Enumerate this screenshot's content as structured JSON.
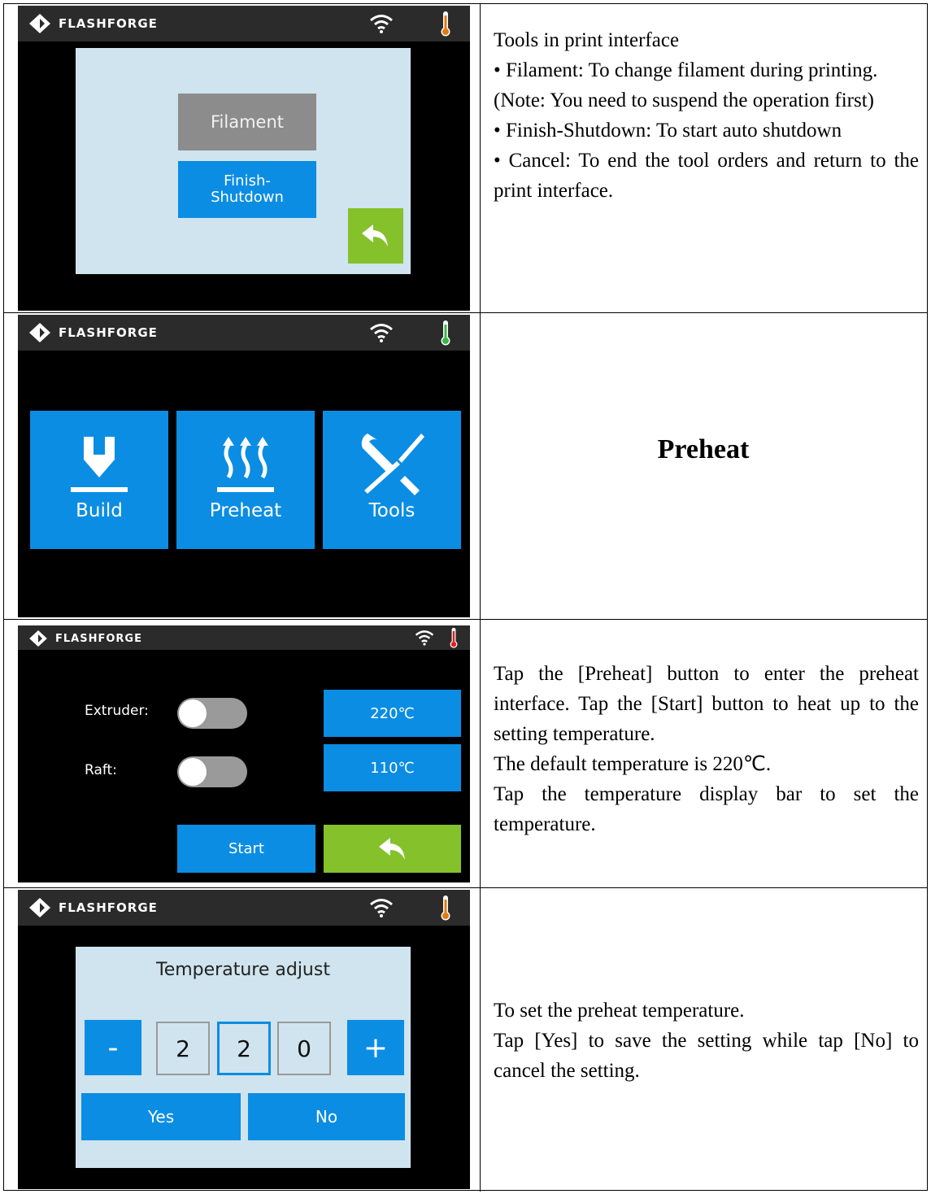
{
  "brand": {
    "name": "FLASHFORGE"
  },
  "rows": [
    {
      "screen": {
        "buttons": {
          "filament": "Filament",
          "finish_shutdown": "Finish-\nShutdown"
        },
        "thermo_color": "#e07b12"
      },
      "description": {
        "title": "Tools in print interface",
        "items": [
          "• Filament: To change filament during printing.",
          "(Note: You need to suspend the operation first)",
          "• Finish-Shutdown: To start auto shutdown",
          "• Cancel: To end the tool orders and return to the print interface."
        ]
      }
    },
    {
      "screen": {
        "tiles": [
          {
            "label": "Build",
            "icon": "build-icon"
          },
          {
            "label": "Preheat",
            "icon": "preheat-icon"
          },
          {
            "label": "Tools",
            "icon": "tools-icon"
          }
        ],
        "thermo_color": "#3cb44a"
      },
      "description": {
        "heading": "Preheat"
      }
    },
    {
      "screen": {
        "extruder_label": "Extruder:",
        "raft_label": "Raft:",
        "extruder_temp": "220℃",
        "raft_temp": "110℃",
        "start_label": "Start",
        "thermo_color": "#e02020"
      },
      "description": {
        "lines": [
          "Tap the [Preheat] button to enter the preheat interface. Tap the [Start] button to heat up to the setting temperature.",
          "The default temperature is 220℃.",
          "Tap the temperature display bar to set the temperature."
        ]
      }
    },
    {
      "screen": {
        "title": "Temperature adjust",
        "minus": "-",
        "plus": "+",
        "digits": [
          "2",
          "2",
          "0"
        ],
        "yes_label": "Yes",
        "no_label": "No",
        "thermo_color": "#e07b12"
      },
      "description": {
        "lines": [
          "To set the preheat temperature.",
          "Tap [Yes] to save the setting while tap [No] to cancel the setting."
        ]
      }
    }
  ],
  "colors": {
    "accent_blue": "#0b8de3",
    "accent_green": "#84c12b",
    "panel_bg": "#cfe4ee"
  }
}
